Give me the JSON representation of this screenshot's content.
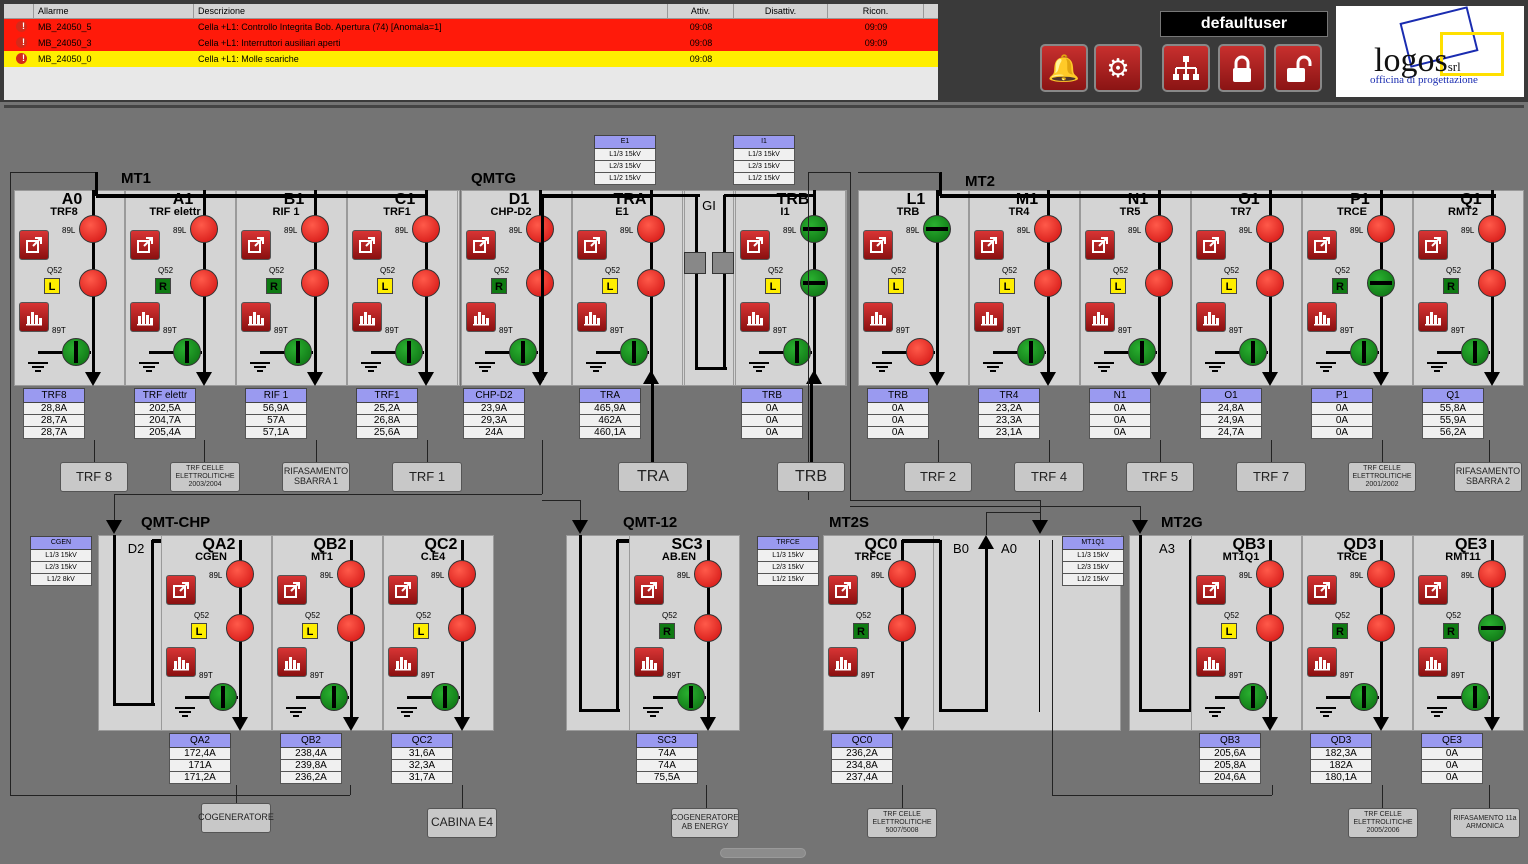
{
  "alarms": {
    "headers": [
      "",
      "Allarme",
      "Descrizione",
      "Attiv.",
      "Disattiv.",
      "Ricon."
    ],
    "rows": [
      {
        "id": "MB_24050_5",
        "desc": "Cella +L1: Controllo Integrita Bob. Apertura (74) [Anomala=1]",
        "attiv": "09:08",
        "disattiv": "",
        "ricon": "09:09",
        "color": "#ff1a0a"
      },
      {
        "id": "MB_24050_3",
        "desc": "Cella +L1: Interruttori ausiliari aperti",
        "attiv": "09:08",
        "disattiv": "",
        "ricon": "09:09",
        "color": "#ff1a0a"
      },
      {
        "id": "MB_24050_0",
        "desc": "Cella +L1: Molle scariche",
        "attiv": "09:08",
        "disattiv": "",
        "ricon": "",
        "color": "#ffee00"
      }
    ]
  },
  "user": "defaultuser",
  "logo": {
    "name": "logos",
    "suffix": "srl",
    "tagline": "officina di progettazione"
  },
  "icons": {
    "alarm": "bell-icon",
    "settings": "gear-icon",
    "hierarchy": "hierarchy-icon",
    "lock": "lock-icon",
    "unlock": "unlock-icon",
    "export": "export-icon",
    "chart": "bar-chart-icon"
  },
  "labels": {
    "l89L": "89L",
    "lQ52": "Q52",
    "l89T": "89T"
  },
  "sections": {
    "mt1": "MT1",
    "qmtg": "QMTG",
    "mt2": "MT2",
    "qmtchp": "QMT-CHP",
    "qmt12": "QMT-12",
    "mt2s": "MT2S",
    "mt2g": "MT2G"
  },
  "gi": "GI",
  "e1box": {
    "title": "E1",
    "vals": [
      "L1/3 15kV",
      "L2/3 15kV",
      "L1/2 15kV"
    ]
  },
  "i1box": {
    "title": "I1",
    "vals": [
      "L1/3 15kV",
      "L2/3 15kV",
      "L1/2 15kV"
    ]
  },
  "cgenbox": {
    "title": "CGEN",
    "vals": [
      "L1/3 15kV",
      "L2/3 15kV",
      "L1/2 8kV"
    ]
  },
  "trfcebox": {
    "title": "TRFCE",
    "vals": [
      "L1/3 15kV",
      "L2/3 15kV",
      "L1/2 15kV"
    ]
  },
  "mt1q1box": {
    "title": "MT1Q1",
    "vals": [
      "L1/3 15kV",
      "L2/3 15kV",
      "L1/2 15kV"
    ]
  },
  "cells": [
    {
      "title": "A0",
      "sub": "TRF8",
      "br": "L",
      "s89L": "red",
      "sQ52": "red",
      "s89T": "grn",
      "meter": "TRF8",
      "vals": [
        "28,8A",
        "28,7A",
        "28,7A"
      ],
      "load": "TRF 8"
    },
    {
      "title": "A1",
      "sub": "TRF elettr",
      "br": "R",
      "s89L": "red",
      "sQ52": "red",
      "s89T": "grn",
      "meter": "TRF elettr",
      "vals": [
        "202,5A",
        "204,7A",
        "205,4A"
      ],
      "load": "TRF CELLE ELETTROLITICHE 2003/2004"
    },
    {
      "title": "B1",
      "sub": "RIF 1",
      "br": "R",
      "s89L": "red",
      "sQ52": "red",
      "s89T": "grn",
      "meter": "RIF 1",
      "vals": [
        "56,9A",
        "57A",
        "57,1A"
      ],
      "load": "RIFASAMENTO SBARRA 1"
    },
    {
      "title": "C1",
      "sub": "TRF1",
      "br": "L",
      "s89L": "red",
      "sQ52": "red",
      "s89T": "grn",
      "meter": "TRF1",
      "vals": [
        "25,2A",
        "26,8A",
        "25,6A"
      ],
      "load": "TRF 1"
    },
    {
      "title": "D1",
      "sub": "CHP-D2",
      "br": "R",
      "s89L": "red",
      "sQ52": "red",
      "s89T": "grn",
      "meter": "CHP-D2",
      "vals": [
        "23,9A",
        "29,3A",
        "24A"
      ],
      "load": ""
    },
    {
      "title": "TRA",
      "sub": "E1",
      "br": "L",
      "s89L": "red",
      "sQ52": "red",
      "s89T": "grn",
      "meter": "TRA",
      "vals": [
        "465,9A",
        "462A",
        "460,1A"
      ],
      "load": "TRA"
    },
    {
      "title": "TRB",
      "sub": "I1",
      "br": "L",
      "s89L": "grn",
      "sQ52": "grn",
      "s89T": "grn",
      "meter": "TRB",
      "vals": [
        "0A",
        "0A",
        "0A"
      ],
      "load": "TRB"
    },
    {
      "title": "L1",
      "sub": "TRB",
      "br": "L",
      "s89L": "grn",
      "sQ52": "none",
      "s89T": "red",
      "meter": "TRB",
      "vals": [
        "0A",
        "0A",
        "0A"
      ],
      "load": "TRF 2"
    },
    {
      "title": "M1",
      "sub": "TR4",
      "br": "L",
      "s89L": "red",
      "sQ52": "red",
      "s89T": "grn",
      "meter": "TR4",
      "vals": [
        "23,2A",
        "23,3A",
        "23,1A"
      ],
      "load": "TRF 4"
    },
    {
      "title": "N1",
      "sub": "TR5",
      "br": "L",
      "s89L": "red",
      "sQ52": "red",
      "s89T": "grn",
      "meter": "N1",
      "vals": [
        "0A",
        "0A",
        "0A"
      ],
      "load": "TRF 5"
    },
    {
      "title": "O1",
      "sub": "TR7",
      "br": "L",
      "s89L": "red",
      "sQ52": "red",
      "s89T": "grn",
      "meter": "O1",
      "vals": [
        "24,8A",
        "24,9A",
        "24,7A"
      ],
      "load": "TRF 7"
    },
    {
      "title": "P1",
      "sub": "TRCE",
      "br": "R",
      "s89L": "red",
      "sQ52": "grn",
      "s89T": "grn",
      "meter": "P1",
      "vals": [
        "0A",
        "0A",
        "0A"
      ],
      "load": "TRF CELLE ELETTROLITICHE 2001/2002"
    },
    {
      "title": "Q1",
      "sub": "RMT2",
      "br": "R",
      "s89L": "red",
      "sQ52": "red",
      "s89T": "grn",
      "meter": "Q1",
      "vals": [
        "55,8A",
        "55,9A",
        "56,2A"
      ],
      "load": "RIFASAMENTO SBARRA 2"
    },
    {
      "title": "QA2",
      "sub": "CGEN",
      "br": "L",
      "s89L": "red",
      "sQ52": "red",
      "s89T": "grn",
      "meter": "QA2",
      "vals": [
        "172,4A",
        "171A",
        "171,2A"
      ],
      "load": "COGENERATORE"
    },
    {
      "title": "QB2",
      "sub": "MT1",
      "br": "L",
      "s89L": "red",
      "sQ52": "red",
      "s89T": "grn",
      "meter": "QB2",
      "vals": [
        "238,4A",
        "239,8A",
        "236,2A"
      ],
      "load": ""
    },
    {
      "title": "QC2",
      "sub": "C.E4",
      "br": "L",
      "s89L": "red",
      "sQ52": "red",
      "s89T": "grn",
      "meter": "QC2",
      "vals": [
        "31,6A",
        "32,3A",
        "31,7A"
      ],
      "load": "CABINA E4"
    },
    {
      "title": "SC3",
      "sub": "AB.EN",
      "br": "R",
      "s89L": "red",
      "sQ52": "red",
      "s89T": "grn",
      "meter": "SC3",
      "vals": [
        "74A",
        "74A",
        "75,5A"
      ],
      "load": "COGENERATORE AB ENERGY"
    },
    {
      "title": "QC0",
      "sub": "TRFCE",
      "br": "R",
      "s89L": "red",
      "sQ52": "red",
      "s89T": "none",
      "meter": "QC0",
      "vals": [
        "236,2A",
        "234,8A",
        "237,4A"
      ],
      "load": "TRF CELLE ELETTROLITICHE 5007/5008"
    },
    {
      "title": "QB3",
      "sub": "MT1Q1",
      "br": "L",
      "s89L": "red",
      "sQ52": "red",
      "s89T": "grn",
      "meter": "QB3",
      "vals": [
        "205,6A",
        "205,8A",
        "204,6A"
      ],
      "load": ""
    },
    {
      "title": "QD3",
      "sub": "TRCE",
      "br": "R",
      "s89L": "red",
      "sQ52": "red",
      "s89T": "grn",
      "meter": "QD3",
      "vals": [
        "182,3A",
        "182A",
        "180,1A"
      ],
      "load": "TRF CELLE ELETTROLITICHE 2005/2006"
    },
    {
      "title": "QE3",
      "sub": "RMT11",
      "br": "R",
      "s89L": "red",
      "sQ52": "grn",
      "s89T": "grn",
      "meter": "QE3",
      "vals": [
        "0A",
        "0A",
        "0A"
      ],
      "load": "RIFASAMENTO 11a ARMONICA"
    }
  ],
  "buscells": {
    "d2": "D2",
    "b0": "B0",
    "a0": "A0",
    "a3": "A3"
  }
}
